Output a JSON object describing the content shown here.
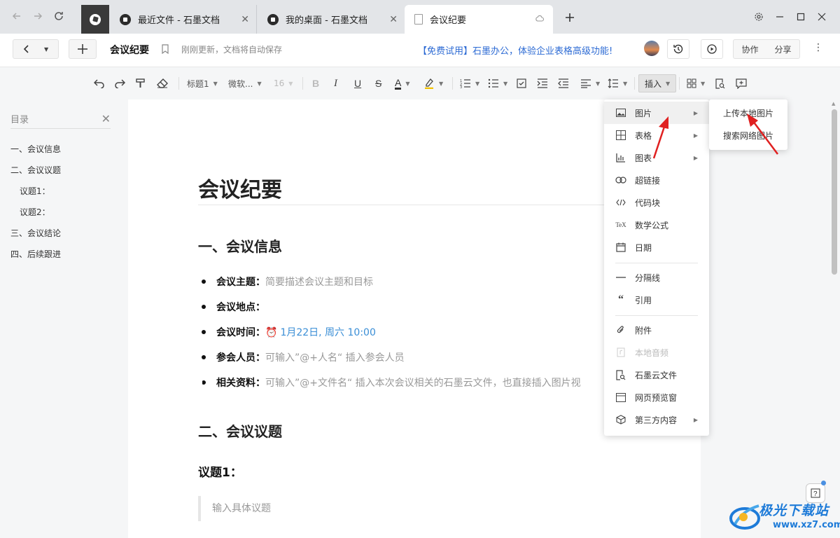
{
  "tabs": [
    {
      "label": "最近文件 - 石墨文档"
    },
    {
      "label": "我的桌面 - 石墨文档"
    },
    {
      "label": "会议纪要"
    }
  ],
  "header": {
    "doc_title": "会议纪要",
    "save_hint": "刚刚更新，文档将自动保存",
    "promo": "【免费试用】石墨办公，体验企业表格高级功能!",
    "collab_label": "协作",
    "share_label": "分享"
  },
  "toolbar": {
    "heading_style": "标题1",
    "font_family": "微软...",
    "font_size": "16",
    "insert_label": "插入"
  },
  "toc": {
    "title": "目录",
    "items": [
      "一、会议信息",
      "二、会议议题",
      "议题1：",
      "议题2：",
      "三、会议结论",
      "四、后续跟进"
    ]
  },
  "document": {
    "title": "会议纪要",
    "section1": "一、会议信息",
    "fields": [
      {
        "label": "会议主题：",
        "value": "简要描述会议主题和目标"
      },
      {
        "label": "会议地点：",
        "value": ""
      },
      {
        "label": "会议时间：",
        "value": "1月22日, 周六 10:00"
      },
      {
        "label": "参会人员：",
        "value": "可输入”@+人名“ 插入参会人员"
      },
      {
        "label": "相关资料：",
        "value": "可输入”@+文件名“ 插入本次会议相关的石墨云文件，也直接插入图片视"
      }
    ],
    "section2": "二、会议议题",
    "topic1": "议题1：",
    "quote_placeholder": "输入具体议题"
  },
  "insert_menu": {
    "items": [
      {
        "label": "图片",
        "icon": "image-icon",
        "submenu": true
      },
      {
        "label": "表格",
        "icon": "table-icon",
        "submenu": true
      },
      {
        "label": "图表",
        "icon": "chart-icon",
        "submenu": true
      },
      {
        "label": "超链接",
        "icon": "link-icon"
      },
      {
        "label": "代码块",
        "icon": "code-icon"
      },
      {
        "label": "数学公式",
        "icon": "tex-icon"
      },
      {
        "label": "日期",
        "icon": "calendar-icon"
      },
      {
        "label": "分隔线",
        "icon": "divider-icon"
      },
      {
        "label": "引用",
        "icon": "quote-icon"
      },
      {
        "label": "附件",
        "icon": "paperclip-icon"
      },
      {
        "label": "本地音频",
        "icon": "audio-icon",
        "disabled": true
      },
      {
        "label": "石墨云文件",
        "icon": "cloud-file-icon"
      },
      {
        "label": "网页预览窗",
        "icon": "web-preview-icon"
      },
      {
        "label": "第三方内容",
        "icon": "cube-icon",
        "submenu": true
      }
    ],
    "image_submenu": [
      "上传本地图片",
      "搜索网络图片"
    ]
  },
  "watermark": {
    "text": "极光下载站",
    "url": "www.xz7.com"
  },
  "colors": {
    "accent_blue": "#2d6bd4",
    "date_blue": "#3a8ed6",
    "arrow_red": "#e02020"
  }
}
